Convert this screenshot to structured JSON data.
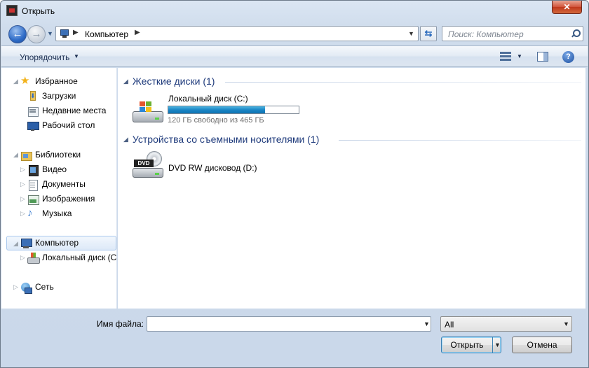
{
  "window": {
    "title": "Открыть",
    "close_label": "✕"
  },
  "nav": {
    "back_glyph": "←",
    "forward_glyph": "→"
  },
  "address": {
    "path": "Компьютер"
  },
  "search": {
    "placeholder": "Поиск: Компьютер"
  },
  "toolbar": {
    "organize_label": "Упорядочить"
  },
  "sidebar": {
    "favorites": {
      "label": "Избранное",
      "items": [
        {
          "label": "Загрузки",
          "icon": "downloads-icon"
        },
        {
          "label": "Недавние места",
          "icon": "recent-places-icon"
        },
        {
          "label": "Рабочий стол",
          "icon": "desktop-icon"
        }
      ]
    },
    "libraries": {
      "label": "Библиотеки",
      "items": [
        {
          "label": "Видео",
          "icon": "video-library-icon"
        },
        {
          "label": "Документы",
          "icon": "documents-library-icon"
        },
        {
          "label": "Изображения",
          "icon": "pictures-library-icon"
        },
        {
          "label": "Музыка",
          "icon": "music-library-icon"
        }
      ]
    },
    "computer": {
      "label": "Компьютер",
      "selected": true,
      "items": [
        {
          "label": "Локальный диск (C",
          "icon": "local-disk-icon"
        }
      ]
    },
    "network": {
      "label": "Сеть"
    }
  },
  "content": {
    "groups": [
      {
        "header": "Жесткие диски (1)",
        "drives": [
          {
            "name": "Локальный диск (C:)",
            "free_text": "120 ГБ свободно из 465 ГБ",
            "used_fraction": 0.742,
            "icon": "hard-drive-icon"
          }
        ]
      },
      {
        "header": "Устройства со съемными носителями (1)",
        "drives": [
          {
            "name": "DVD RW дисковод (D:)",
            "icon": "dvd-drive-icon",
            "badge": "DVD"
          }
        ]
      }
    ]
  },
  "footer": {
    "filename_label": "Имя файла:",
    "filename_value": "",
    "filter_value": "All",
    "open_label": "Открыть",
    "cancel_label": "Отмена"
  },
  "colors": {
    "capacity_fill": "#1b86c5",
    "group_header": "#1e3a7b",
    "selection_border": "#a9c8ed"
  }
}
